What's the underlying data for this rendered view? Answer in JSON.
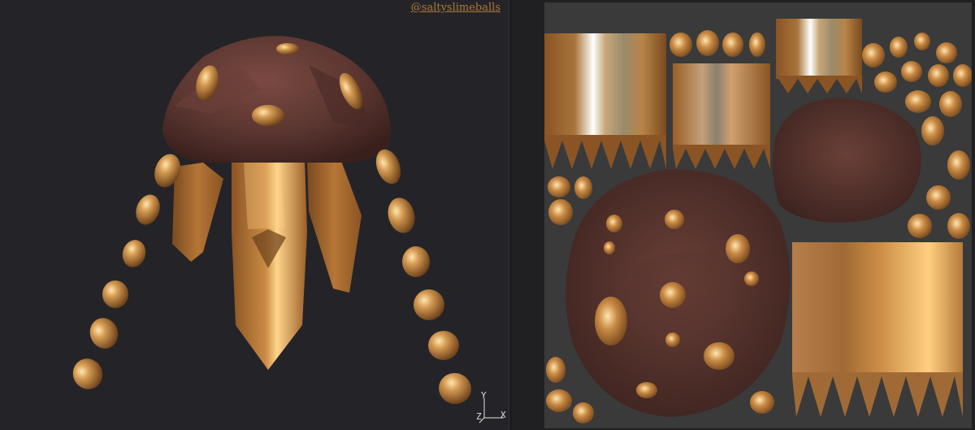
{
  "watermark": "@saltyslimeballs",
  "axis_gizmo": {
    "y_label": "Y",
    "z_label": "Z",
    "x_label": "X"
  },
  "colors": {
    "background": "#242428",
    "uv_background": "#3a3a3a",
    "cap_rock": "#5a3530",
    "crystal": "#b57a3a",
    "crystal_highlight": "#ffd58a",
    "watermark": "#b07a3a"
  },
  "icons": {
    "axis_gizmo": "xyz-axis-icon",
    "model": "jellyfish-crystal-model",
    "texture": "uv-texture-atlas"
  }
}
